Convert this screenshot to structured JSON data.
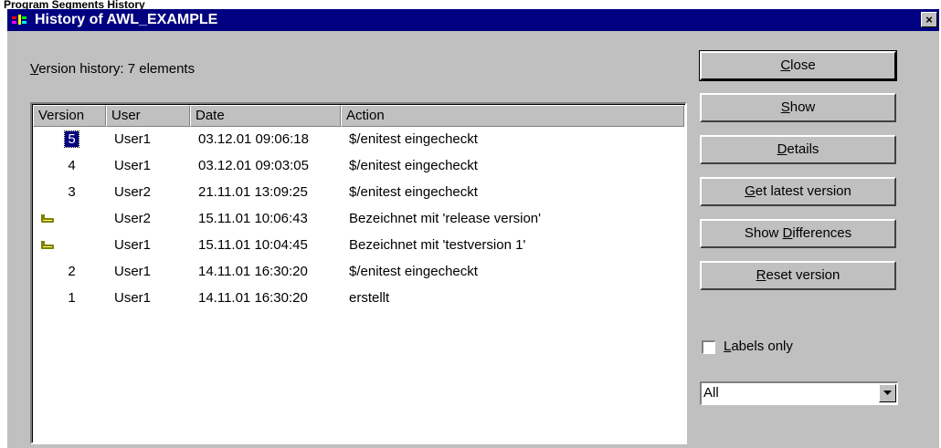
{
  "caption_strip": "Program Segments History",
  "window": {
    "title": "History of AWL_EXAMPLE",
    "close_glyph": "×"
  },
  "history_label": {
    "mnemonic": "V",
    "rest": "ersion history: 7 elements"
  },
  "columns": [
    "Version",
    "User",
    "Date",
    "Action"
  ],
  "rows": [
    {
      "version": "5",
      "user": "User1",
      "date": "03.12.01 09:06:18",
      "action": "$/enitest eingecheckt",
      "selected": true,
      "label": false
    },
    {
      "version": "4",
      "user": "User1",
      "date": "03.12.01 09:03:05",
      "action": "$/enitest eingecheckt",
      "selected": false,
      "label": false
    },
    {
      "version": "3",
      "user": "User2",
      "date": "21.11.01 13:09:25",
      "action": "$/enitest eingecheckt",
      "selected": false,
      "label": false
    },
    {
      "version": "",
      "user": "User2",
      "date": "15.11.01 10:06:43",
      "action": "Bezeichnet mit 'release version'",
      "selected": false,
      "label": true
    },
    {
      "version": "",
      "user": "User1",
      "date": "15.11.01 10:04:45",
      "action": "Bezeichnet mit 'testversion 1'",
      "selected": false,
      "label": true
    },
    {
      "version": "2",
      "user": "User1",
      "date": "14.11.01 16:30:20",
      "action": "$/enitest eingecheckt",
      "selected": false,
      "label": false
    },
    {
      "version": "1",
      "user": "User1",
      "date": "14.11.01 16:30:20",
      "action": "erstellt",
      "selected": false,
      "label": false
    }
  ],
  "buttons": {
    "close": {
      "pre": "",
      "key": "C",
      "post": "lose"
    },
    "show": {
      "pre": "",
      "key": "S",
      "post": "how"
    },
    "details": {
      "pre": "",
      "key": "D",
      "post": "etails"
    },
    "get_latest": {
      "pre": "",
      "key": "G",
      "post": "et latest version"
    },
    "show_differences": {
      "pre": "Show ",
      "key": "D",
      "post": "ifferences"
    },
    "reset_version": {
      "pre": "",
      "key": "R",
      "post": "eset version"
    }
  },
  "labels_only": {
    "pre": "",
    "key": "L",
    "post": "abels only",
    "checked": false
  },
  "filter_select": {
    "value": "All"
  },
  "icons": {
    "label_row": "key-label-icon",
    "window": "app-icon"
  },
  "colors": {
    "titlebar": "#000080",
    "face": "#c0c0c0",
    "selection": "#000080",
    "label_icon": "#808000"
  }
}
